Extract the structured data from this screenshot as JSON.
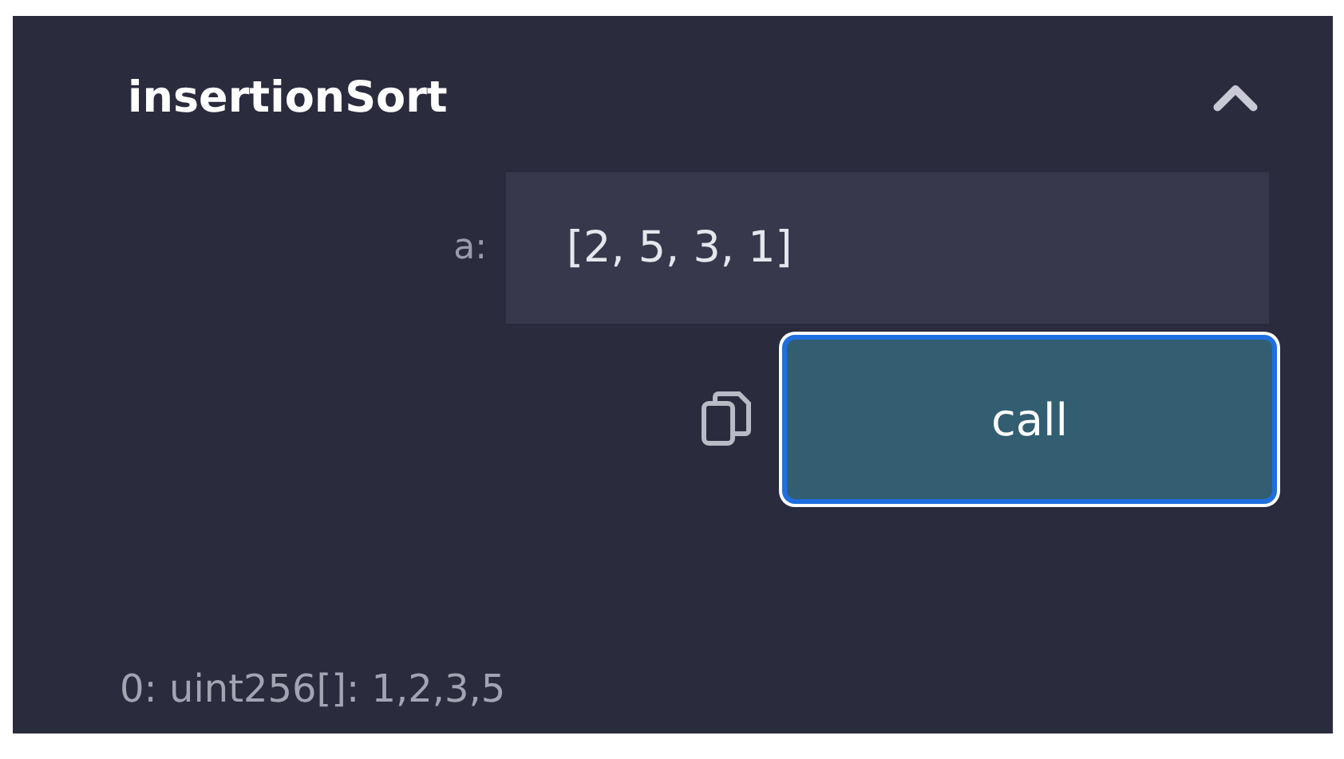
{
  "function": {
    "name": "insertionSort",
    "expanded": true
  },
  "inputs": [
    {
      "label": "a:",
      "value": "[2, 5, 3, 1]"
    }
  ],
  "call_button": {
    "label": "call",
    "focused": true
  },
  "output": "0: uint256[]: 1,2,3,5"
}
